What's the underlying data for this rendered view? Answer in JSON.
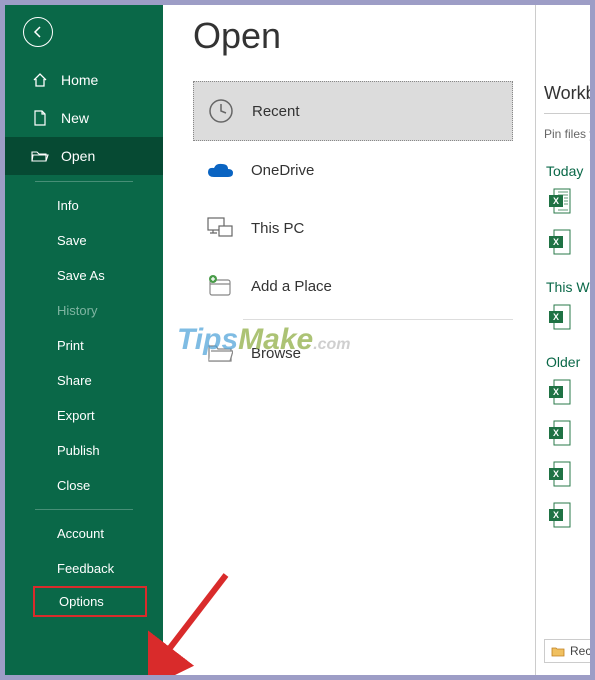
{
  "sidebar": {
    "home": "Home",
    "new": "New",
    "open": "Open",
    "info": "Info",
    "save": "Save",
    "saveAs": "Save As",
    "history": "History",
    "print": "Print",
    "share": "Share",
    "export": "Export",
    "publish": "Publish",
    "close": "Close",
    "account": "Account",
    "feedback": "Feedback",
    "options": "Options"
  },
  "page": {
    "title": "Open"
  },
  "locations": {
    "recent": "Recent",
    "onedrive": "OneDrive",
    "thispc": "This PC",
    "addplace": "Add a Place",
    "browse": "Browse"
  },
  "recentPanel": {
    "title": "Workbooks",
    "pinHint": "Pin files you want",
    "groups": {
      "today": "Today",
      "thisWeek": "This Week",
      "older": "Older"
    },
    "recover": "Recover"
  },
  "watermark": {
    "t": "Tips",
    "m": "Make",
    "com": ".com"
  }
}
